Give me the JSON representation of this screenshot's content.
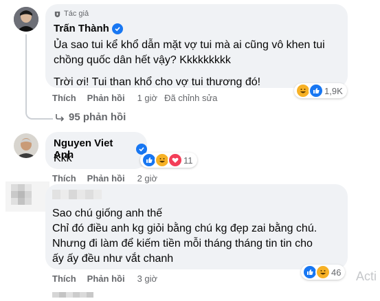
{
  "comments": [
    {
      "author": "Trấn Thành",
      "badge": "Tác giả",
      "text_lines": [
        "Ủa sao tui kể khổ dẫn mặt vợ tui mà ai cũng vô khen tui",
        "chồng quốc dân hết vậy? Kkkkkkkkk"
      ],
      "text_lines_2": [
        "Trời ơi! Tui than khổ cho vợ tui thương đó!"
      ],
      "like_label": "Thích",
      "reply_label": "Phản hồi",
      "time": "1 giờ",
      "edited": "Đã chỉnh sửa",
      "reaction_count": "1,9K",
      "reactions": [
        "haha-icon",
        "like-icon"
      ]
    },
    {
      "author": "Nguyen Viet Anh",
      "text": "Kkk",
      "like_label": "Thích",
      "reply_label": "Phản hồi",
      "time": "2 giờ",
      "reaction_count": "11",
      "reactions": [
        "like-icon",
        "haha-icon",
        "love-icon"
      ]
    },
    {
      "author": "",
      "text_lines": [
        "Sao chú giống anh thế",
        "Chỉ đó điều anh kg giỏi bằng chú kg đẹp zai bằng chú.",
        "Nhưng đi làm để kiếm tiền mỗi tháng tháng tin tin cho",
        "ấy ấy đều như vắt chanh"
      ],
      "like_label": "Thích",
      "reply_label": "Phản hồi",
      "time": "3 giờ",
      "reaction_count": "46",
      "reactions": [
        "like-icon",
        "haha-icon"
      ]
    }
  ],
  "replies_link": "95 phản hồi",
  "watermark": "Acti",
  "colors": {
    "bubble": "#f0f2f5",
    "meta_text": "#65676b",
    "verified": "#1877f2",
    "love": "#f33e58",
    "haha": "#f7b125"
  }
}
